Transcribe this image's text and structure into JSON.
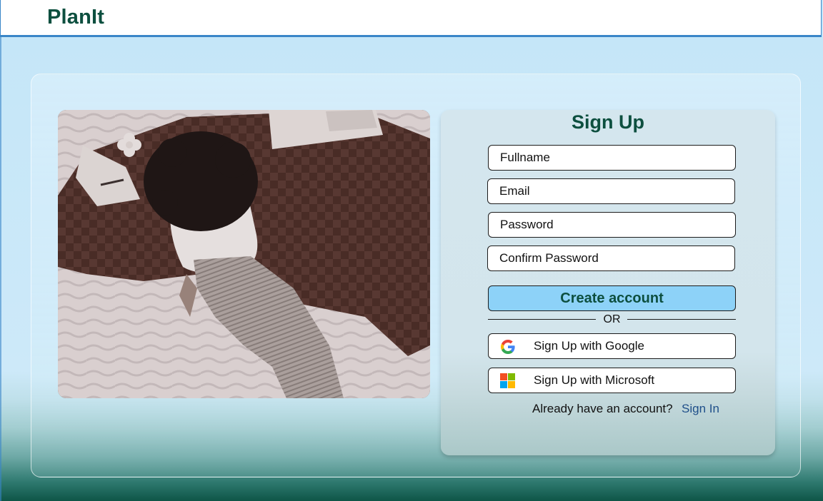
{
  "app": {
    "brand": "PlanIt"
  },
  "signup": {
    "title": "Sign Up",
    "fields": {
      "fullname_placeholder": "Fullname",
      "email_placeholder": "Email",
      "password_placeholder": "Password",
      "confirm_placeholder": "Confirm Password"
    },
    "create_label": "Create account",
    "divider": "OR",
    "google_label": "Sign Up with Google",
    "microsoft_label": "Sign Up with Microsoft",
    "account_prompt": "Already have an account?",
    "signin_link": "Sign In"
  },
  "colors": {
    "brand": "#0d4f3f",
    "primary_button": "#8dd2f8",
    "link": "#1f4f8a",
    "header_border": "#3a86c8"
  },
  "icons": {
    "google": "google-g-logo",
    "microsoft": "microsoft-four-squares-logo"
  }
}
